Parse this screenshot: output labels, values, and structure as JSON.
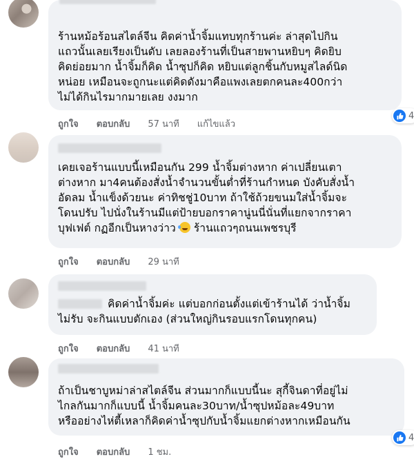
{
  "comments": [
    {
      "text": "ร้านหม้อร้อนสไตล์จีน คิดค่าน้ำจิ้มแทบทุกร้านค่ะ ล่าสุดไปกิน\nแถวนั้นเลยเรียงเป็นดับ เลยลองร้านที่เป็นสายพานหยิบๆ คิดยิบ\nคิดย่อยมาก น้ำจิ้มก็คิด น้ำซุปก็คิด หยิบแต่ลูกชิ้นกับหมูสไลด์นิด\nหน่อย เหมือนจะถูกนะแต่คิดดังมาคือแพงเลยตกคนละ400กว่า\nไม่ได้กินไรมากมายเลย งงมาก",
      "like": "ถูกใจ",
      "reply": "ตอบกลับ",
      "time": "57 นาที",
      "edited": "แก้ไขแล้ว",
      "reaction_count": "4"
    },
    {
      "text": "เคยเจอร้านแบบนี้เหมือนกัน 299 น้ำจิ้มต่างหาก ค่าเปลี่ยนเตา\nต่างหาก มา4คนต้องสั่งน้ำจำนวนขั้นต่ำที่ร้านกำหนด บังคับสั่งน้ำ\nอัดลม น้ำแข็งด้วยนะ ค่าทิชชู่10บาท ถ้าใช้ถ้วยขนมใส่น้ำจิ้มจะ\nโดนปรับ ไปนั่งในร้านมีแต่ป้ายบอกราคานู่นนี่นั่นที่แยกจากราคา\nบุฟเฟต์ กฏอีกเป็นหางว่าว",
      "text_tail": "ร้านแถวๆถนนเพชรบุรี",
      "like": "ถูกใจ",
      "reply": "ตอบกลับ",
      "time": "29 นาที"
    },
    {
      "text_line1": "คิดค่าน้ำจิ้มค่ะ แต่บอกก่อนตั้งแต่เข้าร้านได้ ว่าน้ำจิ้ม",
      "text_rest": "ไม่รับ จะกินแบบตักเอง (ส่วนใหญ่กินรอบแรกโดนทุกคน)",
      "like": "ถูกใจ",
      "reply": "ตอบกลับ",
      "time": "41 นาที"
    },
    {
      "text": "ถ้าเป็นชาบูหม่าล่าสไตล์จีน ส่วนมากก็แบบนี้นะ สุกี้จินดาที่อยู่ไม่\nไกลกันมากก็แบบนี้ น้ำจิ้มคนละ30บาท/น้ำซุปหม้อละ49บาท\nหรืออย่างไห่ตี้เหลาก็คิดค่าน้ำซุปกับน้ำจิ้มแยกต่างหากเหมือนกัน",
      "like": "ถูกใจ",
      "reply": "ตอบกลับ",
      "time": "1 ชม.",
      "reaction_count": "4"
    }
  ],
  "colors": {
    "bubble": "#f0f2f5",
    "meta": "#65676b",
    "like_blue": "#1877f2"
  },
  "icons": {
    "reaction": "like-reaction-icon",
    "emoji": "rofl-emoji-icon"
  }
}
